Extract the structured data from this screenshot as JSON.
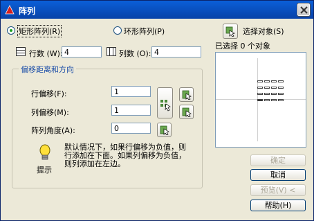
{
  "window": {
    "title": "阵列"
  },
  "mode": {
    "rect_label": "矩形阵列",
    "rect_key": "(R)",
    "polar_label": "环形阵列",
    "polar_key": "(P)"
  },
  "rows": {
    "label": "行数",
    "key": "(W):",
    "value": "4"
  },
  "cols": {
    "label": "列数",
    "key": "(O):",
    "value": "4"
  },
  "group": {
    "title": "偏移距离和方向",
    "row_offset": {
      "label": "行偏移",
      "key": "(F):",
      "value": "1"
    },
    "col_offset": {
      "label": "列偏移",
      "key": "(M):",
      "value": "1"
    },
    "angle": {
      "label": "阵列角度",
      "key": "(A):",
      "value": "0"
    },
    "tip_label": "提示",
    "tip_line1": "默认情况下，如果行偏移为负值，则",
    "tip_line2": "行添加在下面。如果列偏移为负值，",
    "tip_line3": "则列添加在左边。"
  },
  "select": {
    "label": "选择对象",
    "key": "(S)",
    "count_text": "已选择 0 个对象"
  },
  "buttons": {
    "ok": "确定",
    "cancel": "取消",
    "preview": "预览(V) <",
    "help": "帮助(H)"
  },
  "colors": {
    "accent": "#0a5fd8",
    "group_title": "#1d4fa8",
    "radio_dot": "#21a121"
  }
}
